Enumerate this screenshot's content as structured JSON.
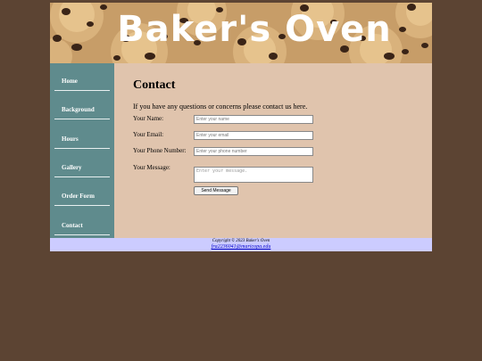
{
  "header": {
    "site_title": "Baker's Oven"
  },
  "nav": {
    "items": [
      {
        "label": "Home"
      },
      {
        "label": "Background"
      },
      {
        "label": "Hours"
      },
      {
        "label": "Gallery"
      },
      {
        "label": "Order Form"
      },
      {
        "label": "Contact"
      }
    ]
  },
  "main": {
    "title": "Contact",
    "intro": "If you have any questions or concerns please contact us here.",
    "form": {
      "name_label": "Your Name:",
      "name_placeholder": "Enter your name",
      "email_label": "Your Email:",
      "email_placeholder": "Enter your email",
      "phone_label": "Your Phone Number:",
      "phone_placeholder": "Enter your phone number",
      "message_label": "Your Message:",
      "message_placeholder": "Enter your message.",
      "submit_label": "Send Message"
    }
  },
  "footer": {
    "copyright": "Copyright © 2023 Baker's Oven",
    "email": "fra2236041@maricopa.edu"
  },
  "colors": {
    "page_background": "#5c4433",
    "content_background": "#e0c4ad",
    "nav_background": "#5f8b8d",
    "footer_background": "#ccccff",
    "link": "#0000cc"
  }
}
